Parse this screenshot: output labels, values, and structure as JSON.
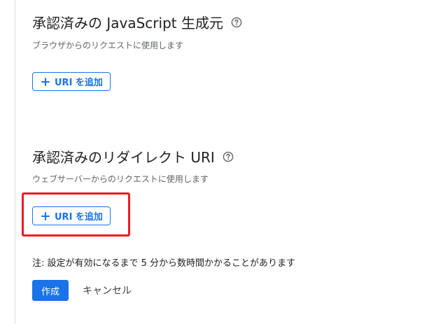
{
  "js_origins": {
    "title": "承認済みの JavaScript 生成元",
    "description": "ブラウザからのリクエストに使用します",
    "add_label": "URI を追加",
    "help_icon": "help-circle-icon"
  },
  "redirect_uris": {
    "title": "承認済みのリダイレクト URI",
    "description": "ウェブサーバーからのリクエストに使用します",
    "add_label": "URI を追加",
    "help_icon": "help-circle-icon"
  },
  "note": "注: 設定が有効になるまで 5 分から数時間かかることがあります",
  "actions": {
    "create_label": "作成",
    "cancel_label": "キャンセル"
  },
  "colors": {
    "accent": "#1a73e8",
    "highlight": "#ea1c24"
  }
}
